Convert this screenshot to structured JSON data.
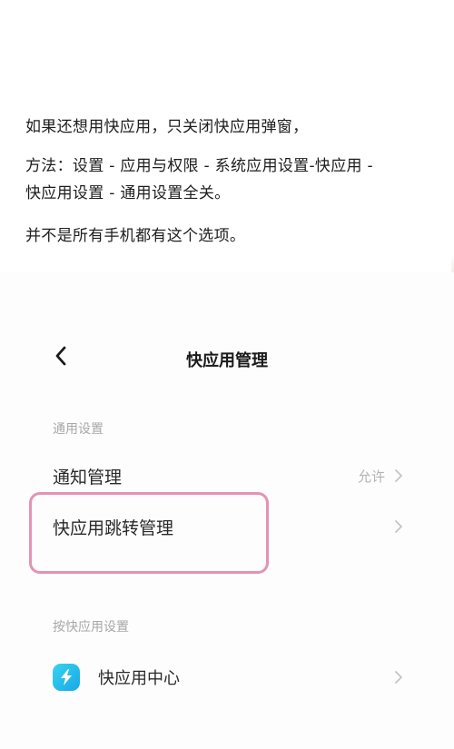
{
  "article": {
    "line1": "如果还想用快应用，只关闭快应用弹窗，",
    "line2a": "方法：设置 - 应用与权限 - 系统应用设置-快应用 -",
    "line2b": "快应用设置 - 通用设置全关。",
    "line3": "并不是所有手机都有这个选项。"
  },
  "screen": {
    "title": "快应用管理",
    "section_general": "通用设置",
    "notification_label": "通知管理",
    "notification_value": "允许",
    "redirect_label": "快应用跳转管理",
    "section_per_app": "按快应用设置",
    "app_center_label": "快应用中心"
  },
  "colors": {
    "highlight_border": "#e592b4",
    "app_icon": "#1fb6ea"
  },
  "icons": {
    "back": "chevron-left-icon",
    "chevron": "chevron-right-icon",
    "app": "lightning-icon"
  }
}
